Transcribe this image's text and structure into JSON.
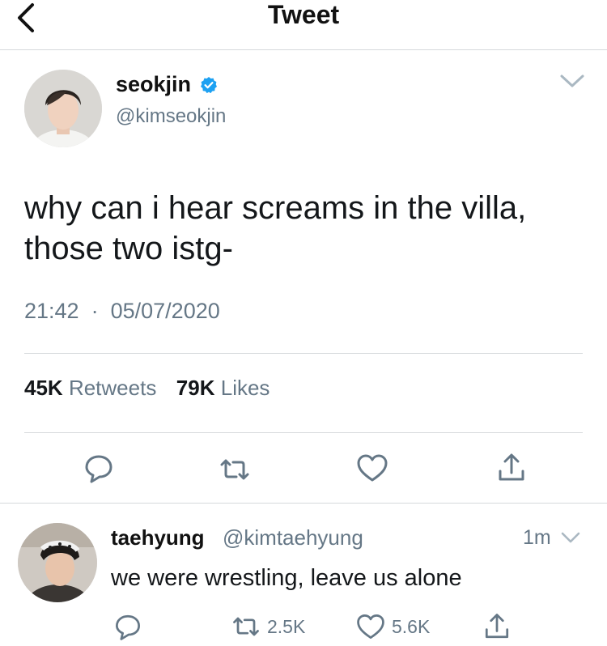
{
  "header": {
    "title": "Tweet",
    "back_icon": "chevron-left-icon"
  },
  "tweet": {
    "author_name": "seokjin",
    "author_handle": "@kimseokjin",
    "verified": true,
    "text": "why can i hear screams in the villa, those two istg-",
    "time": "21:42",
    "date": "05/07/2020",
    "retweets_count": "45K",
    "retweets_label": "Retweets",
    "likes_count": "79K",
    "likes_label": "Likes"
  },
  "reply": {
    "author_name": "taehyung",
    "author_handle": "@kimtaehyung",
    "time": "1m",
    "text": "we were wrestling, leave us alone",
    "retweets": "2.5K",
    "likes": "5.6K"
  },
  "colors": {
    "accent": "#1da1f2",
    "secondary_text": "#657786",
    "divider": "#d6d9dc"
  }
}
